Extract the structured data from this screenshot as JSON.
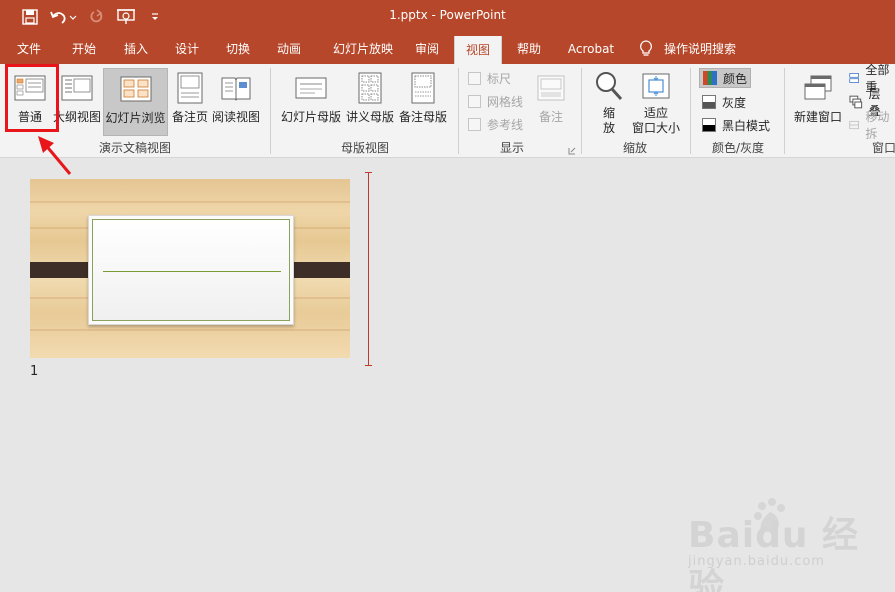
{
  "window": {
    "title": "1.pptx  -  PowerPoint"
  },
  "tabs": [
    {
      "label": "文件"
    },
    {
      "label": "开始"
    },
    {
      "label": "插入"
    },
    {
      "label": "设计"
    },
    {
      "label": "切换"
    },
    {
      "label": "动画"
    },
    {
      "label": "幻灯片放映"
    },
    {
      "label": "审阅"
    },
    {
      "label": "视图",
      "active": true
    },
    {
      "label": "帮助"
    },
    {
      "label": "Acrobat"
    },
    {
      "label": "操作说明搜索"
    }
  ],
  "ribbon": {
    "presentation_views": {
      "label": "演示文稿视图",
      "normal": "普通",
      "outline": "大纲视图",
      "slide_sorter": "幻灯片浏览",
      "notes_page": "备注页",
      "reading_view": "阅读视图"
    },
    "master_views": {
      "label": "母版视图",
      "slide_master": "幻灯片母版",
      "handout_master": "讲义母版",
      "notes_master": "备注母版"
    },
    "show": {
      "label": "显示",
      "ruler": "标尺",
      "gridlines": "网格线",
      "guides": "参考线",
      "notes": "备注"
    },
    "zoom": {
      "label": "缩放",
      "zoom": "缩\n放",
      "fit_window": "适应\n窗口大小"
    },
    "color": {
      "label": "颜色/灰度",
      "color": "颜色",
      "grayscale": "灰度",
      "black_white": "黑白模式"
    },
    "window": {
      "label": "窗口",
      "new_window": "新建窗口",
      "arrange_all": "全部重",
      "cascade": "层叠",
      "move_split": "移动拆"
    }
  },
  "slides": [
    {
      "number": "1"
    }
  ],
  "watermark": {
    "brand": "Baidu 经验",
    "url": "jingyan.baidu.com"
  },
  "colors": {
    "accent": "#b7472a",
    "highlight": "#e8151b"
  }
}
